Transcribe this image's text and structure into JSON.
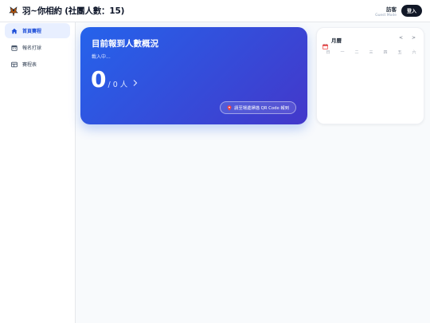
{
  "header": {
    "title": "羽~你相約 (社團人數：15)",
    "user_name": "訪客",
    "user_mode": "Guest Mode",
    "login_label": "登入"
  },
  "sidebar": {
    "items": [
      {
        "label": "首頁賽程",
        "icon": "home-icon",
        "active": true
      },
      {
        "label": "報名打球",
        "icon": "calendar-icon",
        "active": false
      },
      {
        "label": "賽程表",
        "icon": "table-icon",
        "active": false
      }
    ]
  },
  "hero": {
    "title": "目前報到人數概況",
    "loading": "載入中...",
    "count": "0",
    "total": "/ 0 人",
    "qr_button": "請至場邊掃描 QR Code 報到"
  },
  "calendar": {
    "title": "月曆",
    "prev": "<",
    "next": ">",
    "weekdays": [
      "日",
      "一",
      "二",
      "三",
      "四",
      "五",
      "六"
    ]
  },
  "colors": {
    "accent": "#2563eb",
    "accent_dark": "#4338ca",
    "login_bg": "#111827"
  }
}
